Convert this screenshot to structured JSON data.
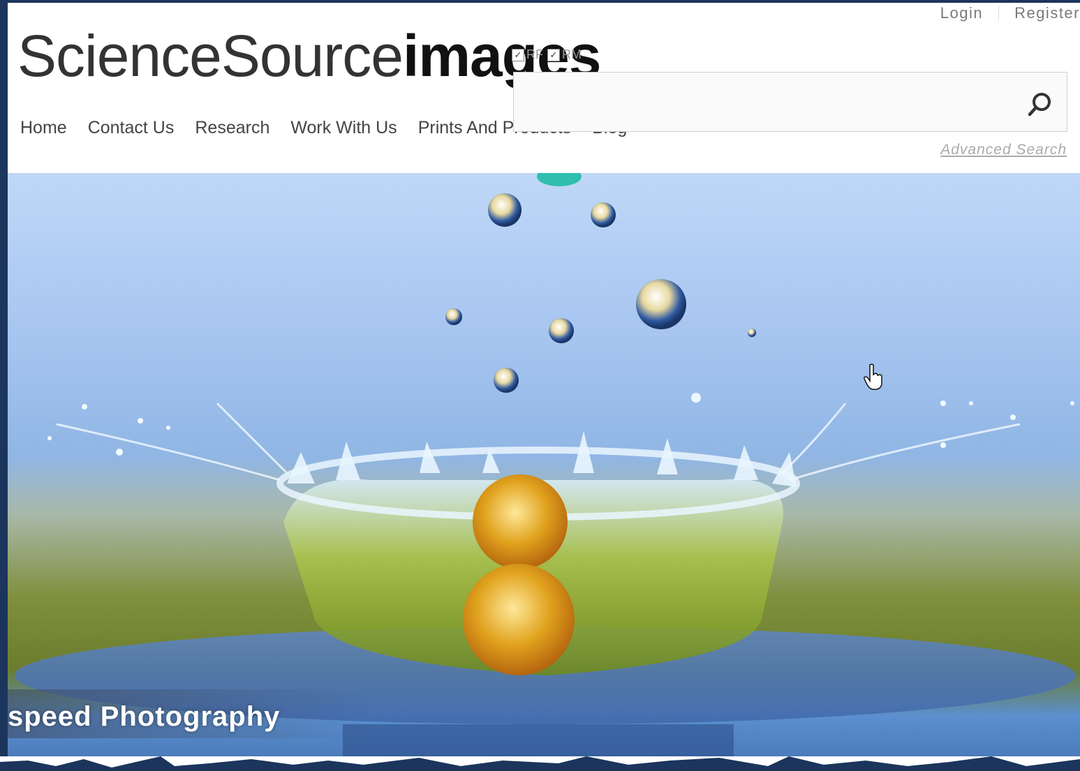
{
  "header": {
    "login_label": "Login",
    "register_label": "Register",
    "logo_light": "ScienceSource",
    "logo_bold": "images",
    "license_rf": "RF",
    "license_rm": "RM"
  },
  "nav": {
    "items": [
      "Home",
      "Contact Us",
      "Research",
      "Work With Us",
      "Prints And Products",
      "Blog"
    ]
  },
  "search": {
    "value": "",
    "placeholder": "",
    "advanced_label": "Advanced Search"
  },
  "hero": {
    "caption": "speed Photography"
  },
  "colors": {
    "frame": "#1b355c",
    "accent": "#333333"
  }
}
